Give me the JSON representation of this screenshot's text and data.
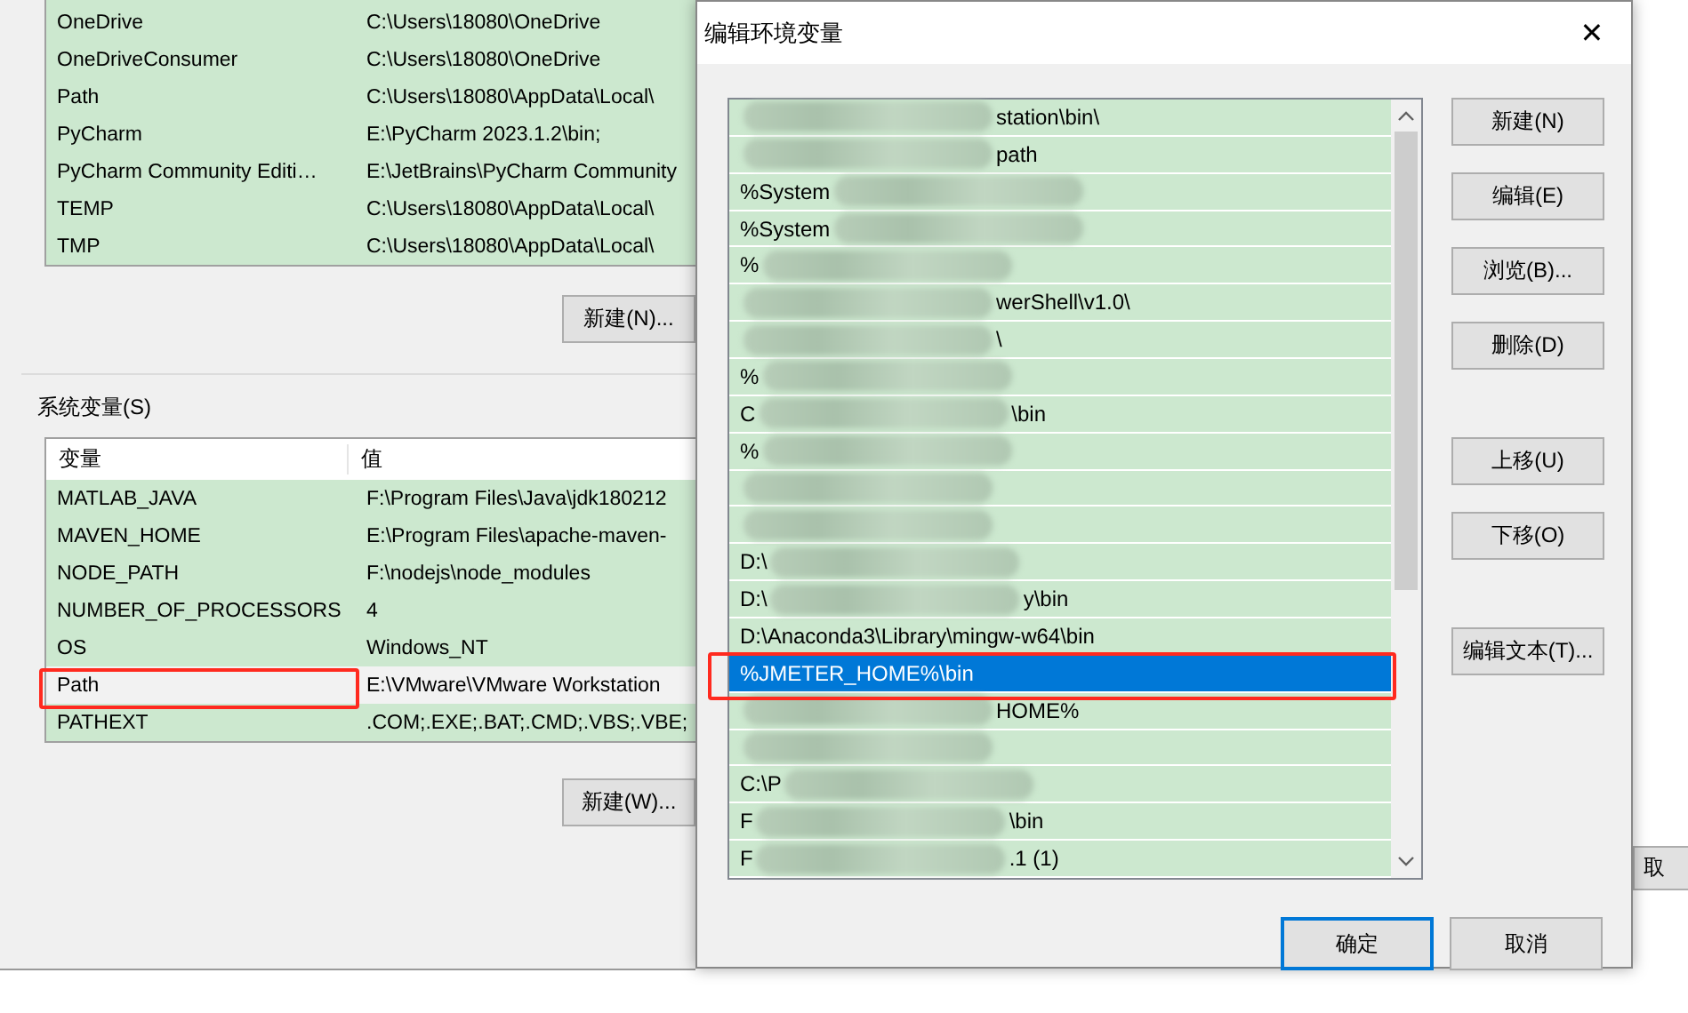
{
  "user_variables": {
    "rows": [
      {
        "name": "OneDrive",
        "value": "C:\\Users\\18080\\OneDrive",
        "selected": false,
        "annotated": false
      },
      {
        "name": "OneDriveConsumer",
        "value": "C:\\Users\\18080\\OneDrive",
        "selected": false,
        "annotated": false
      },
      {
        "name": "Path",
        "value": "C:\\Users\\18080\\AppData\\Local\\",
        "selected": false,
        "annotated": false
      },
      {
        "name": "PyCharm",
        "value": "E:\\PyCharm 2023.1.2\\bin;",
        "selected": false,
        "annotated": false
      },
      {
        "name": "PyCharm Community Editi…",
        "value": "E:\\JetBrains\\PyCharm Community",
        "selected": false,
        "annotated": false
      },
      {
        "name": "TEMP",
        "value": "C:\\Users\\18080\\AppData\\Local\\",
        "selected": false,
        "annotated": false
      },
      {
        "name": "TMP",
        "value": "C:\\Users\\18080\\AppData\\Local\\",
        "selected": false,
        "annotated": false
      }
    ],
    "new_button": "新建(N)..."
  },
  "system_variables": {
    "group_label": "系统变量(S)",
    "columns": [
      "变量",
      "值"
    ],
    "rows": [
      {
        "name": "MATLAB_JAVA",
        "value": "F:\\Program Files\\Java\\jdk180212",
        "selected": false,
        "annotated": false
      },
      {
        "name": "MAVEN_HOME",
        "value": "E:\\Program Files\\apache-maven-",
        "selected": false,
        "annotated": false
      },
      {
        "name": "NODE_PATH",
        "value": "F:\\nodejs\\node_modules",
        "selected": false,
        "annotated": false
      },
      {
        "name": "NUMBER_OF_PROCESSORS",
        "value": "4",
        "selected": false,
        "annotated": false
      },
      {
        "name": "OS",
        "value": "Windows_NT",
        "selected": false,
        "annotated": false
      },
      {
        "name": "Path",
        "value": "E:\\VMware\\VMware Workstation",
        "selected": true,
        "annotated": true
      },
      {
        "name": "PATHEXT",
        "value": ".COM;.EXE;.BAT;.CMD;.VBS;.VBE;",
        "selected": false,
        "annotated": false
      }
    ],
    "new_button": "新建(W)..."
  },
  "dialog": {
    "title": "编辑环境变量",
    "close": "✕",
    "entries": [
      {
        "suffix": "station\\bin\\",
        "blurred": true,
        "selected": false,
        "annotated": false
      },
      {
        "suffix": "path",
        "blurred": true,
        "selected": false,
        "annotated": false
      },
      {
        "prefix": "%System",
        "blurred": true,
        "selected": false,
        "annotated": false
      },
      {
        "prefix": "%System",
        "blurred": true,
        "selected": false,
        "annotated": false
      },
      {
        "prefix": "%",
        "blurred": true,
        "selected": false,
        "annotated": false
      },
      {
        "suffix": "werShell\\v1.0\\",
        "blurred": true,
        "selected": false,
        "annotated": false
      },
      {
        "suffix": "\\",
        "blurred": true,
        "selected": false,
        "annotated": false
      },
      {
        "prefix": "%",
        "blurred": true,
        "selected": false,
        "annotated": false
      },
      {
        "prefix": "C",
        "suffix": "\\bin",
        "blurred": true,
        "selected": false,
        "annotated": false
      },
      {
        "prefix": "%",
        "blurred": true,
        "selected": false,
        "annotated": false
      },
      {
        "blurred": true,
        "selected": false,
        "annotated": false
      },
      {
        "blurred": true,
        "selected": false,
        "annotated": false
      },
      {
        "prefix": "D:\\",
        "blurred": true,
        "selected": false,
        "annotated": false
      },
      {
        "prefix": "D:\\",
        "suffix": "y\\bin",
        "blurred": true,
        "selected": false,
        "annotated": false
      },
      {
        "prefix": "D:\\Anaconda3\\Library\\mingw-w64\\bin",
        "blurred": false,
        "selected": false,
        "annotated": false
      },
      {
        "prefix": "%JMETER_HOME%\\bin",
        "blurred": false,
        "selected": true,
        "annotated": true
      },
      {
        "suffix": "HOME%",
        "blurred": true,
        "selected": false,
        "annotated": false
      },
      {
        "blurred": true,
        "selected": false,
        "annotated": false
      },
      {
        "prefix": "C:\\P",
        "blurred": true,
        "selected": false,
        "annotated": false
      },
      {
        "prefix": "F",
        "suffix": "\\bin",
        "blurred": true,
        "selected": false,
        "annotated": false
      },
      {
        "prefix": "F",
        "suffix": ".1 (1)",
        "blurred": true,
        "selected": false,
        "annotated": false
      }
    ],
    "side_button_groups": [
      [
        "新建(N)",
        "编辑(E)",
        "浏览(B)...",
        "删除(D)"
      ],
      [
        "上移(U)",
        "下移(O)"
      ],
      [
        "编辑文本(T)..."
      ]
    ],
    "ok_button": {
      "label": "确定",
      "default": true
    },
    "cancel_button": {
      "label": "取消",
      "default": false
    }
  },
  "background_window": {
    "button": "取"
  }
}
